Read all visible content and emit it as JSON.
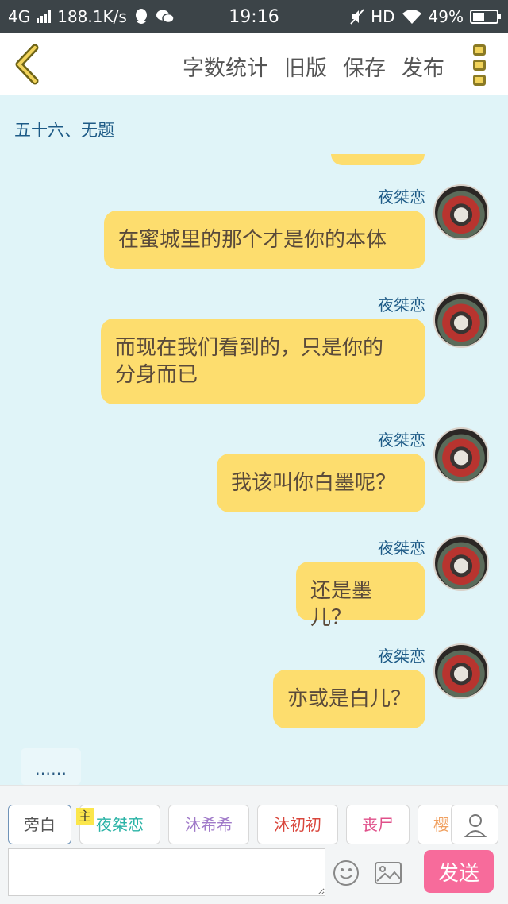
{
  "status_bar": {
    "network": "4G",
    "speed": "188.1K/s",
    "time": "19:16",
    "hd": "HD",
    "battery": "49%",
    "battery_level": 0.49
  },
  "toolbar": {
    "word_count": "字数统计",
    "old_version": "旧版",
    "save": "保存",
    "publish": "发布"
  },
  "chapter_title": "五十六、无题",
  "messages": [
    {
      "name": "夜桀恋",
      "lines": [
        "在蜜城里的那个才是你的本体"
      ]
    },
    {
      "name": "夜桀恋",
      "lines": [
        "而现在我们看到的，只是你的",
        "分身而已"
      ]
    },
    {
      "name": "夜桀恋",
      "lines": [
        "我该叫你白墨呢？"
      ]
    },
    {
      "name": "夜桀恋",
      "lines": [
        "还是墨儿？"
      ]
    },
    {
      "name": "夜桀恋",
      "lines": [
        "亦或是白儿？"
      ]
    }
  ],
  "narration_preview": "……",
  "roles": {
    "host_tag": "主",
    "items": [
      {
        "label": "旁白",
        "color": "#555555"
      },
      {
        "label": "夜桀恋",
        "color": "#2bb3a6"
      },
      {
        "label": "沐希希",
        "color": "#a07ac9"
      },
      {
        "label": "沐初初",
        "color": "#d9463c"
      },
      {
        "label": "丧尸",
        "color": "#e0508a"
      },
      {
        "label": "樱",
        "color": "#f0a060"
      }
    ]
  },
  "input": {
    "value": "",
    "placeholder": ""
  },
  "send_label": "发送",
  "colors": {
    "accent_yellow": "#fddd6e",
    "chat_bg": "#e0f4f8",
    "send_pink": "#f76b9b",
    "name_blue": "#1d5a86"
  }
}
